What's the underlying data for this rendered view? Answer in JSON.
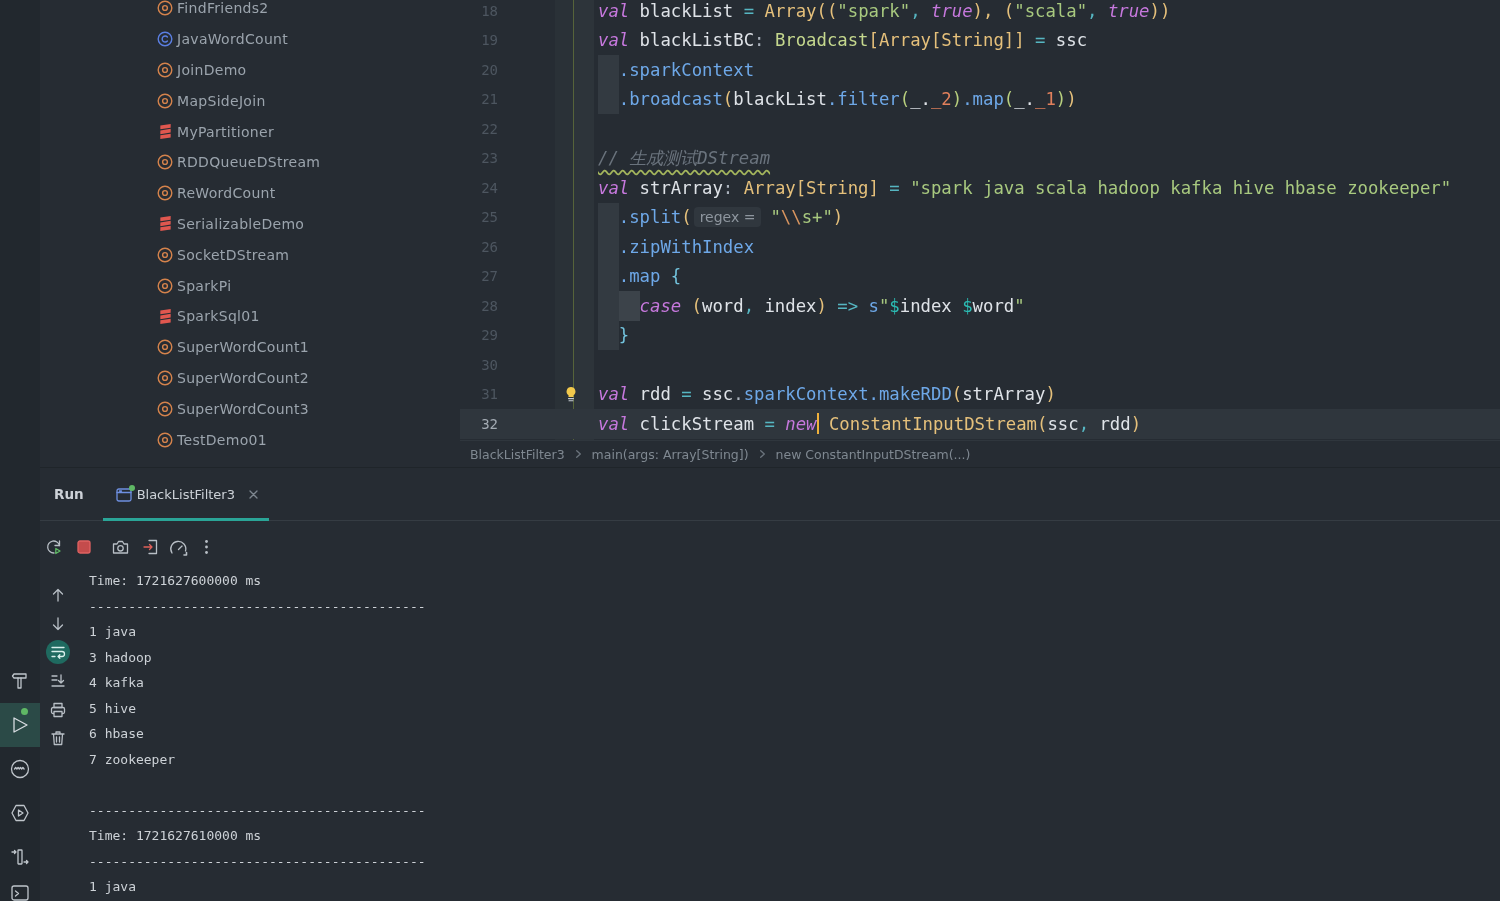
{
  "tool_strip": [
    {
      "kind": "hammer",
      "selected": false,
      "running": false
    },
    {
      "kind": "play",
      "selected": true,
      "running": true
    },
    {
      "kind": "wave-circle",
      "selected": false,
      "running": false
    },
    {
      "kind": "hex-play",
      "selected": false,
      "running": false
    },
    {
      "kind": "bar-arrows",
      "selected": false,
      "running": false
    },
    {
      "kind": "terminal",
      "selected": false,
      "running": false
    }
  ],
  "project_tree": {
    "items": [
      {
        "label": "FindFriends2",
        "kind": "object",
        "selected": false
      },
      {
        "label": "JavaWordCount",
        "kind": "class",
        "selected": false
      },
      {
        "label": "JoinDemo",
        "kind": "object",
        "selected": false
      },
      {
        "label": "MapSideJoin",
        "kind": "object",
        "selected": false
      },
      {
        "label": "MyPartitioner",
        "kind": "file",
        "selected": false
      },
      {
        "label": "RDDQueueDStream",
        "kind": "object",
        "selected": false
      },
      {
        "label": "ReWordCount",
        "kind": "object",
        "selected": false
      },
      {
        "label": "SerializableDemo",
        "kind": "file",
        "selected": false
      },
      {
        "label": "SocketDStream",
        "kind": "object",
        "selected": false
      },
      {
        "label": "SparkPi",
        "kind": "object",
        "selected": false
      },
      {
        "label": "SparkSql01",
        "kind": "file",
        "selected": false
      },
      {
        "label": "SuperWordCount1",
        "kind": "object",
        "selected": false
      },
      {
        "label": "SuperWordCount2",
        "kind": "object",
        "selected": false
      },
      {
        "label": "SuperWordCount3",
        "kind": "object",
        "selected": false
      },
      {
        "label": "TestDemo01",
        "kind": "object",
        "selected": false
      }
    ]
  },
  "editor": {
    "lines": [
      {
        "number": "18",
        "current": false,
        "bulb": false,
        "tokens": [
          {
            "text": "val",
            "kind": "keyword"
          },
          {
            "text": " blackList",
            "kind": "ident"
          },
          {
            "text": " = ",
            "kind": "operator"
          },
          {
            "text": "Array",
            "kind": "type"
          },
          {
            "text": "((",
            "kind": "paren"
          },
          {
            "text": "\"spark\"",
            "kind": "string"
          },
          {
            "text": ", ",
            "kind": "operator"
          },
          {
            "text": "true",
            "kind": "keyword"
          },
          {
            "text": "), (",
            "kind": "paren"
          },
          {
            "text": "\"scala\"",
            "kind": "string"
          },
          {
            "text": ", ",
            "kind": "operator"
          },
          {
            "text": "true",
            "kind": "keyword"
          },
          {
            "text": "))",
            "kind": "paren"
          }
        ]
      },
      {
        "number": "19",
        "current": false,
        "bulb": false,
        "tokens": [
          {
            "text": "val",
            "kind": "keyword"
          },
          {
            "text": " blackListBC",
            "kind": "ident"
          },
          {
            "text": ": ",
            "kind": "punct"
          },
          {
            "text": "Broadcast",
            "kind": "class"
          },
          {
            "text": "[",
            "kind": "paren"
          },
          {
            "text": "Array[String]]",
            "kind": "type"
          },
          {
            "text": " = ",
            "kind": "operator"
          },
          {
            "text": "ssc",
            "kind": "ident"
          }
        ]
      },
      {
        "number": "20",
        "current": false,
        "bulb": false,
        "tokens": [
          {
            "kind": "indent"
          },
          {
            "text": ".sparkContext",
            "kind": "method"
          }
        ]
      },
      {
        "number": "21",
        "current": false,
        "bulb": false,
        "tokens": [
          {
            "kind": "indent"
          },
          {
            "text": ".broadcast",
            "kind": "method"
          },
          {
            "text": "(",
            "kind": "paren"
          },
          {
            "text": "blackList",
            "kind": "ident"
          },
          {
            "text": ".filter",
            "kind": "method"
          },
          {
            "text": "(",
            "kind": "paren2"
          },
          {
            "text": "_.",
            "kind": "ident"
          },
          {
            "text": "_2",
            "kind": "number"
          },
          {
            "text": ")",
            "kind": "paren2"
          },
          {
            "text": ".map",
            "kind": "method"
          },
          {
            "text": "(",
            "kind": "paren2"
          },
          {
            "text": "_.",
            "kind": "ident"
          },
          {
            "text": "_1",
            "kind": "number"
          },
          {
            "text": ")",
            "kind": "paren2"
          },
          {
            "text": ")",
            "kind": "paren"
          }
        ]
      },
      {
        "number": "22",
        "current": false,
        "bulb": false
      },
      {
        "number": "23",
        "current": false,
        "bulb": false,
        "tokens": [
          {
            "text": "// 生成测试DStream",
            "kind": "comment"
          }
        ]
      },
      {
        "number": "24",
        "current": false,
        "bulb": false,
        "tokens": [
          {
            "text": "val",
            "kind": "keyword"
          },
          {
            "text": " strArray",
            "kind": "ident"
          },
          {
            "text": ": ",
            "kind": "punct"
          },
          {
            "text": "Array[String]",
            "kind": "type"
          },
          {
            "text": " = ",
            "kind": "operator"
          },
          {
            "text": "\"spark java scala hadoop kafka hive hbase zookeeper\"",
            "kind": "string"
          }
        ]
      },
      {
        "number": "25",
        "current": false,
        "bulb": false,
        "tokens": [
          {
            "kind": "indent"
          },
          {
            "text": ".split",
            "kind": "method"
          },
          {
            "text": "(",
            "kind": "paren"
          },
          {
            "text": "regex =",
            "kind": "hint"
          },
          {
            "text": "\"",
            "kind": "string"
          },
          {
            "text": "\\\\",
            "kind": "escape"
          },
          {
            "text": "s+\"",
            "kind": "string"
          },
          {
            "text": ")",
            "kind": "paren"
          }
        ]
      },
      {
        "number": "26",
        "current": false,
        "bulb": false,
        "tokens": [
          {
            "kind": "indent"
          },
          {
            "text": ".zipWithIndex",
            "kind": "method"
          }
        ]
      },
      {
        "number": "27",
        "current": false,
        "bulb": false,
        "tokens": [
          {
            "kind": "indent"
          },
          {
            "text": ".map",
            "kind": "method"
          },
          {
            "text": " {",
            "kind": "brace"
          }
        ]
      },
      {
        "number": "28",
        "current": false,
        "bulb": false,
        "tokens": [
          {
            "kind": "indent"
          },
          {
            "kind": "indent2"
          },
          {
            "text": "case",
            "kind": "keyword"
          },
          {
            "text": " (",
            "kind": "paren"
          },
          {
            "text": "word",
            "kind": "ident"
          },
          {
            "text": ", ",
            "kind": "operator"
          },
          {
            "text": "index",
            "kind": "ident"
          },
          {
            "text": ")",
            "kind": "paren"
          },
          {
            "text": " => ",
            "kind": "operator"
          },
          {
            "text": "s",
            "kind": "method"
          },
          {
            "text": "\"",
            "kind": "string"
          },
          {
            "text": "$",
            "kind": "interp"
          },
          {
            "text": "index ",
            "kind": "ident"
          },
          {
            "text": "$",
            "kind": "interp"
          },
          {
            "text": "word",
            "kind": "ident"
          },
          {
            "text": "\"",
            "kind": "string"
          }
        ]
      },
      {
        "number": "29",
        "current": false,
        "bulb": false,
        "tokens": [
          {
            "kind": "indent"
          },
          {
            "text": "}",
            "kind": "brace"
          }
        ]
      },
      {
        "number": "30",
        "current": false,
        "bulb": false
      },
      {
        "number": "31",
        "current": false,
        "bulb": true,
        "tokens": [
          {
            "text": "val",
            "kind": "keyword"
          },
          {
            "text": " rdd",
            "kind": "ident"
          },
          {
            "text": " = ",
            "kind": "operator"
          },
          {
            "text": "ssc",
            "kind": "ident"
          },
          {
            "text": ".",
            "kind": "punct"
          },
          {
            "text": "sparkContext",
            "kind": "method"
          },
          {
            "text": ".makeRDD",
            "kind": "method"
          },
          {
            "text": "(",
            "kind": "paren"
          },
          {
            "text": "strArray",
            "kind": "ident"
          },
          {
            "text": ")",
            "kind": "paren"
          }
        ]
      },
      {
        "number": "32",
        "current": true,
        "bulb": false,
        "tokens": [
          {
            "text": "val",
            "kind": "keyword"
          },
          {
            "text": " clickStream",
            "kind": "ident"
          },
          {
            "text": " = ",
            "kind": "operator"
          },
          {
            "text": "new",
            "kind": "keyword"
          },
          {
            "kind": "caret"
          },
          {
            "text": " ConstantInputDStream",
            "kind": "type"
          },
          {
            "text": "(",
            "kind": "paren"
          },
          {
            "text": "ssc",
            "kind": "ident"
          },
          {
            "text": ", ",
            "kind": "operator"
          },
          {
            "text": "rdd",
            "kind": "ident"
          },
          {
            "text": ")",
            "kind": "paren"
          }
        ]
      }
    ],
    "breadcrumbs": [
      "BlackListFilter3",
      "main(args: Array[String])",
      "new ConstantInputDStream(...)"
    ]
  },
  "run_panel": {
    "title": "Run",
    "tabs": [
      {
        "label": "BlackListFilter3",
        "selected": true,
        "running": true
      }
    ],
    "toolbar": [
      {
        "kind": "rerun"
      },
      {
        "kind": "stop"
      },
      {
        "kind": "camera"
      },
      {
        "kind": "box-arrow"
      },
      {
        "kind": "gauge"
      },
      {
        "kind": "more"
      }
    ],
    "side_toolbar": [
      {
        "kind": "up",
        "on": false
      },
      {
        "kind": "down",
        "on": false
      },
      {
        "kind": "wrap",
        "on": true
      },
      {
        "kind": "scroll-end",
        "on": false
      },
      {
        "kind": "print",
        "on": false
      },
      {
        "kind": "trash",
        "on": false
      }
    ],
    "output": [
      {
        "lines": [
          "Time: 1721627600000 ms",
          "-------------------------------------------",
          "1 java",
          "3 hadoop",
          "4 kafka",
          "5 hive",
          "6 hbase",
          "7 zookeeper"
        ]
      },
      {
        "lines": [
          "-------------------------------------------",
          "Time: 1721627610000 ms",
          "-------------------------------------------",
          "1 java"
        ]
      }
    ]
  }
}
